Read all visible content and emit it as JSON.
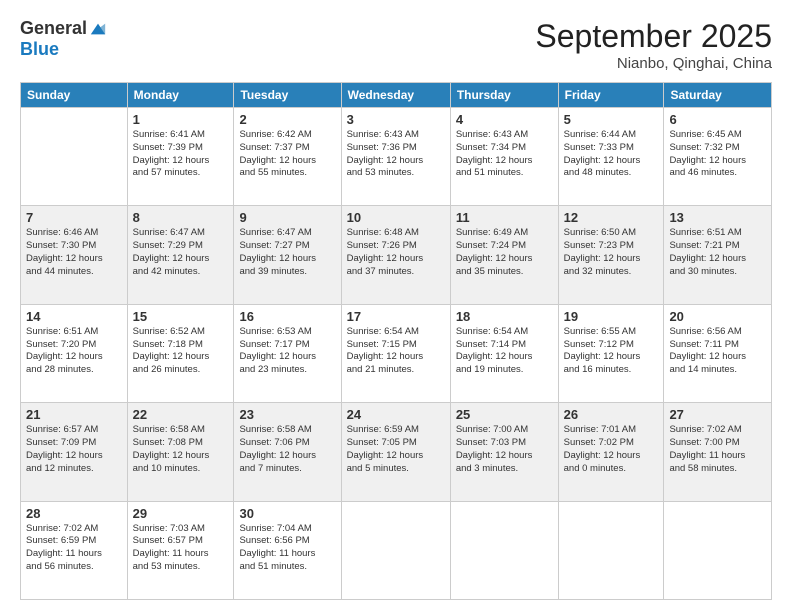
{
  "header": {
    "logo_general": "General",
    "logo_blue": "Blue",
    "month_title": "September 2025",
    "location": "Nianbo, Qinghai, China"
  },
  "weekdays": [
    "Sunday",
    "Monday",
    "Tuesday",
    "Wednesday",
    "Thursday",
    "Friday",
    "Saturday"
  ],
  "weeks": [
    [
      {
        "day": "",
        "info": ""
      },
      {
        "day": "1",
        "info": "Sunrise: 6:41 AM\nSunset: 7:39 PM\nDaylight: 12 hours\nand 57 minutes."
      },
      {
        "day": "2",
        "info": "Sunrise: 6:42 AM\nSunset: 7:37 PM\nDaylight: 12 hours\nand 55 minutes."
      },
      {
        "day": "3",
        "info": "Sunrise: 6:43 AM\nSunset: 7:36 PM\nDaylight: 12 hours\nand 53 minutes."
      },
      {
        "day": "4",
        "info": "Sunrise: 6:43 AM\nSunset: 7:34 PM\nDaylight: 12 hours\nand 51 minutes."
      },
      {
        "day": "5",
        "info": "Sunrise: 6:44 AM\nSunset: 7:33 PM\nDaylight: 12 hours\nand 48 minutes."
      },
      {
        "day": "6",
        "info": "Sunrise: 6:45 AM\nSunset: 7:32 PM\nDaylight: 12 hours\nand 46 minutes."
      }
    ],
    [
      {
        "day": "7",
        "info": "Sunrise: 6:46 AM\nSunset: 7:30 PM\nDaylight: 12 hours\nand 44 minutes."
      },
      {
        "day": "8",
        "info": "Sunrise: 6:47 AM\nSunset: 7:29 PM\nDaylight: 12 hours\nand 42 minutes."
      },
      {
        "day": "9",
        "info": "Sunrise: 6:47 AM\nSunset: 7:27 PM\nDaylight: 12 hours\nand 39 minutes."
      },
      {
        "day": "10",
        "info": "Sunrise: 6:48 AM\nSunset: 7:26 PM\nDaylight: 12 hours\nand 37 minutes."
      },
      {
        "day": "11",
        "info": "Sunrise: 6:49 AM\nSunset: 7:24 PM\nDaylight: 12 hours\nand 35 minutes."
      },
      {
        "day": "12",
        "info": "Sunrise: 6:50 AM\nSunset: 7:23 PM\nDaylight: 12 hours\nand 32 minutes."
      },
      {
        "day": "13",
        "info": "Sunrise: 6:51 AM\nSunset: 7:21 PM\nDaylight: 12 hours\nand 30 minutes."
      }
    ],
    [
      {
        "day": "14",
        "info": "Sunrise: 6:51 AM\nSunset: 7:20 PM\nDaylight: 12 hours\nand 28 minutes."
      },
      {
        "day": "15",
        "info": "Sunrise: 6:52 AM\nSunset: 7:18 PM\nDaylight: 12 hours\nand 26 minutes."
      },
      {
        "day": "16",
        "info": "Sunrise: 6:53 AM\nSunset: 7:17 PM\nDaylight: 12 hours\nand 23 minutes."
      },
      {
        "day": "17",
        "info": "Sunrise: 6:54 AM\nSunset: 7:15 PM\nDaylight: 12 hours\nand 21 minutes."
      },
      {
        "day": "18",
        "info": "Sunrise: 6:54 AM\nSunset: 7:14 PM\nDaylight: 12 hours\nand 19 minutes."
      },
      {
        "day": "19",
        "info": "Sunrise: 6:55 AM\nSunset: 7:12 PM\nDaylight: 12 hours\nand 16 minutes."
      },
      {
        "day": "20",
        "info": "Sunrise: 6:56 AM\nSunset: 7:11 PM\nDaylight: 12 hours\nand 14 minutes."
      }
    ],
    [
      {
        "day": "21",
        "info": "Sunrise: 6:57 AM\nSunset: 7:09 PM\nDaylight: 12 hours\nand 12 minutes."
      },
      {
        "day": "22",
        "info": "Sunrise: 6:58 AM\nSunset: 7:08 PM\nDaylight: 12 hours\nand 10 minutes."
      },
      {
        "day": "23",
        "info": "Sunrise: 6:58 AM\nSunset: 7:06 PM\nDaylight: 12 hours\nand 7 minutes."
      },
      {
        "day": "24",
        "info": "Sunrise: 6:59 AM\nSunset: 7:05 PM\nDaylight: 12 hours\nand 5 minutes."
      },
      {
        "day": "25",
        "info": "Sunrise: 7:00 AM\nSunset: 7:03 PM\nDaylight: 12 hours\nand 3 minutes."
      },
      {
        "day": "26",
        "info": "Sunrise: 7:01 AM\nSunset: 7:02 PM\nDaylight: 12 hours\nand 0 minutes."
      },
      {
        "day": "27",
        "info": "Sunrise: 7:02 AM\nSunset: 7:00 PM\nDaylight: 11 hours\nand 58 minutes."
      }
    ],
    [
      {
        "day": "28",
        "info": "Sunrise: 7:02 AM\nSunset: 6:59 PM\nDaylight: 11 hours\nand 56 minutes."
      },
      {
        "day": "29",
        "info": "Sunrise: 7:03 AM\nSunset: 6:57 PM\nDaylight: 11 hours\nand 53 minutes."
      },
      {
        "day": "30",
        "info": "Sunrise: 7:04 AM\nSunset: 6:56 PM\nDaylight: 11 hours\nand 51 minutes."
      },
      {
        "day": "",
        "info": ""
      },
      {
        "day": "",
        "info": ""
      },
      {
        "day": "",
        "info": ""
      },
      {
        "day": "",
        "info": ""
      }
    ]
  ]
}
